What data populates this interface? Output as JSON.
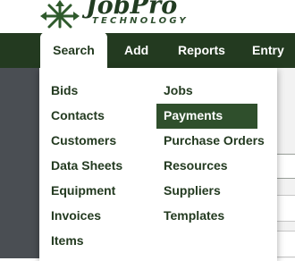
{
  "logo": {
    "name": "JobPro",
    "tagline": "TECHNOLOGY",
    "icon": "arrows-compass-icon"
  },
  "nav": {
    "active": "Search",
    "items": [
      "Add",
      "Reports",
      "Entry"
    ]
  },
  "dropdown": {
    "left_items": [
      "Bids",
      "Contacts",
      "Customers",
      "Data Sheets",
      "Equipment",
      "Invoices",
      "Items"
    ],
    "right_items": [
      "Jobs",
      "Payments",
      "Purchase Orders",
      "Resources",
      "Suppliers",
      "Templates"
    ],
    "highlighted": "Payments"
  },
  "colors": {
    "nav_bg": "#233a20",
    "highlight_bg": "#2f4f2c",
    "text": "#233a20"
  }
}
